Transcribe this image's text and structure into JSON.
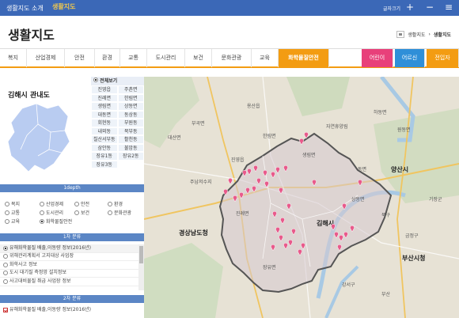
{
  "topbar": {
    "about": "생활지도 소개",
    "logo": "생활지도",
    "font_size": "글자크기",
    "plus": "+",
    "minus": "−",
    "menu": "≡"
  },
  "header": {
    "title": "생활지도",
    "breadcrumb": [
      "생활지도",
      "생활지도"
    ]
  },
  "nav": {
    "tabs": [
      "복지",
      "산업경제",
      "안전",
      "환경",
      "교통",
      "도시관리",
      "보건",
      "문화관광",
      "교육",
      "화학물질안전"
    ],
    "active": "화학물질안전",
    "special": [
      "어린이",
      "어르신",
      "전입자"
    ]
  },
  "sidebar": {
    "region_title": "김해시 관내도",
    "view_all": "전체보기",
    "districts": [
      [
        "진영읍",
        "주촌면"
      ],
      [
        "진례면",
        "한림면"
      ],
      [
        "생림면",
        "상동면"
      ],
      [
        "대동면",
        "동상동"
      ],
      [
        "회현동",
        "부원동"
      ],
      [
        "내외동",
        "북부동"
      ],
      [
        "칠산서부동",
        "활천동"
      ],
      [
        "삼안동",
        "불암동"
      ],
      [
        "장유1동",
        "장유2동"
      ],
      [
        "장유3동",
        ""
      ]
    ],
    "depth1_header": "1depth",
    "categories": [
      "복지",
      "산업경제",
      "안전",
      "환경",
      "교통",
      "도시관리",
      "보건",
      "문화관광",
      "교육",
      "화학물질안전"
    ],
    "depth2_header": "1차 분류",
    "list1": [
      "유해화학물질 배출,이동량 정보(2016년)",
      "위해관리계획서 고지대상 사업장",
      "화학사고 정보",
      "도시 대기질 측정망 설치정보",
      "사고대비물질 취급 사업장 정보"
    ],
    "depth3_header": "2차 분류",
    "list2": [
      "유해화학물질 배출,이동량 정보(2016년)"
    ]
  },
  "map": {
    "labels": [
      {
        "text": "용산읍",
        "big": false
      },
      {
        "text": "부곡면",
        "big": false
      },
      {
        "text": "대산면",
        "big": false
      },
      {
        "text": "자연휴양림",
        "big": false
      },
      {
        "text": "한림면",
        "big": false
      },
      {
        "text": "생림면",
        "big": false
      },
      {
        "text": "하동면",
        "big": false
      },
      {
        "text": "원동면",
        "big": false
      },
      {
        "text": "진영읍",
        "big": false
      },
      {
        "text": "동면",
        "big": false
      },
      {
        "text": "양산시",
        "big": false
      },
      {
        "text": "주남저수지",
        "big": false
      },
      {
        "text": "상동면",
        "big": false
      },
      {
        "text": "진례면",
        "big": false
      },
      {
        "text": "북구",
        "big": false
      },
      {
        "text": "김해시",
        "big": false
      },
      {
        "text": "경상남도청",
        "big": true
      },
      {
        "text": "금정구",
        "big": false
      },
      {
        "text": "부산시청",
        "big": true
      },
      {
        "text": "기장군",
        "big": false
      },
      {
        "text": "장유면",
        "big": false
      },
      {
        "text": "강서구",
        "big": false
      },
      {
        "text": "부산",
        "big": false
      }
    ],
    "accent": "#e85a8b"
  },
  "colors": {
    "topbar": "#3b68b7",
    "nav_active": "#f39c12",
    "section_header": "#5b86c5",
    "kids": "#e8407a",
    "seniors": "#2f8fd8",
    "newcomers": "#f39c12"
  }
}
